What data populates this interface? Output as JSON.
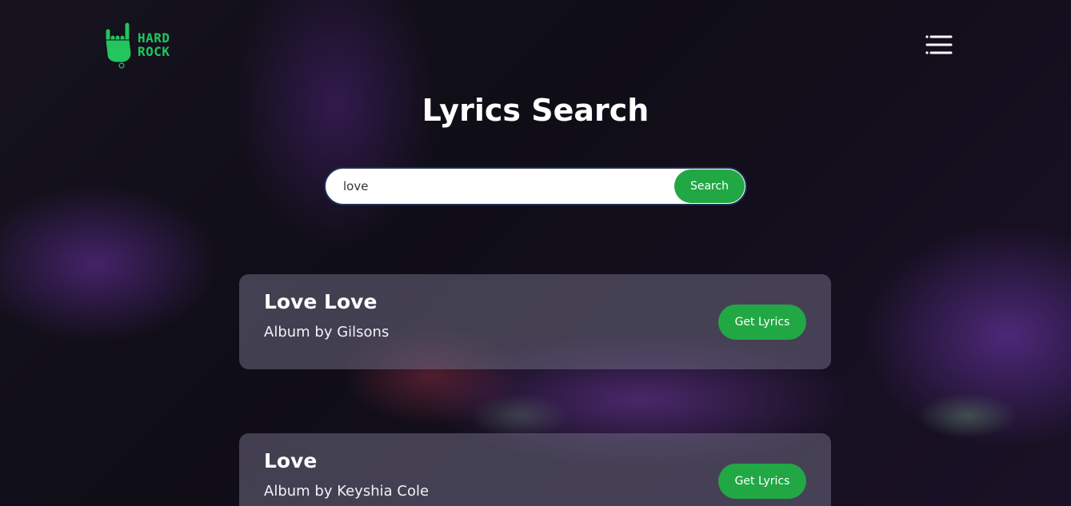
{
  "header": {
    "logo_line1": "HARD",
    "logo_line2": "ROCK",
    "accent_color": "#22c55e",
    "menu_icon": "hamburger-menu-icon"
  },
  "main": {
    "title": "Lyrics Search",
    "search": {
      "value": "love",
      "placeholder": "",
      "button_label": "Search"
    },
    "results": [
      {
        "title": "Love Love",
        "subtitle": "Album by Gilsons",
        "button_label": "Get Lyrics"
      },
      {
        "title": "Love",
        "subtitle": "Album by Keyshia Cole",
        "button_label": "Get Lyrics"
      }
    ]
  },
  "colors": {
    "button_green": "#22a745",
    "search_border": "#1b2f55"
  }
}
